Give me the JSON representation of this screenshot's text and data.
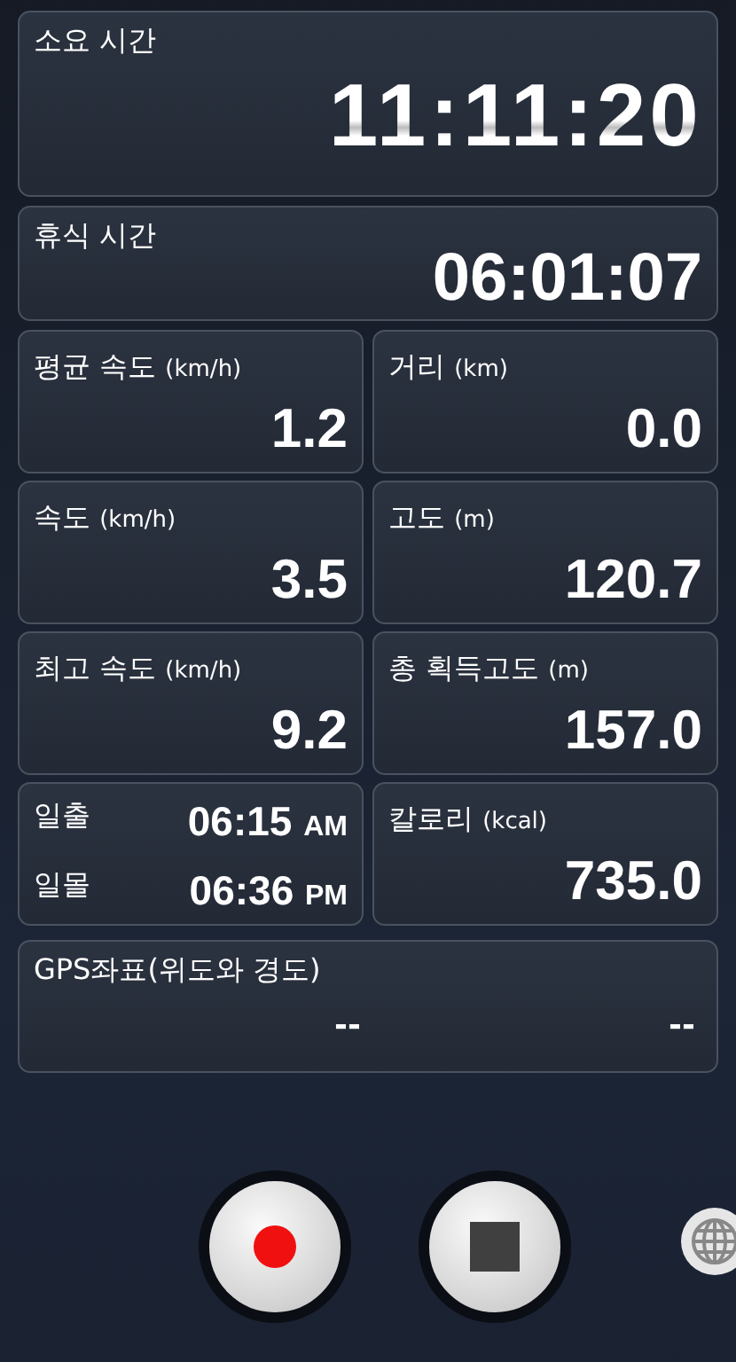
{
  "elapsed": {
    "label": "소요 시간",
    "value": "11:11:20"
  },
  "rest": {
    "label": "휴식 시간",
    "value": "06:01:07"
  },
  "cells": [
    {
      "kind": "stat",
      "label": "평균 속도",
      "unit": "(km/h)",
      "value": "1.2"
    },
    {
      "kind": "stat",
      "label": "거리",
      "unit": "(km)",
      "value": "0.0"
    },
    {
      "kind": "stat",
      "label": "속도",
      "unit": "(km/h)",
      "value": "3.5"
    },
    {
      "kind": "stat",
      "label": "고도",
      "unit": "(m)",
      "value": "120.7"
    },
    {
      "kind": "stat",
      "label": "최고 속도",
      "unit": "(km/h)",
      "value": "9.2"
    },
    {
      "kind": "stat",
      "label": "총 획득고도",
      "unit": "(m)",
      "value": "157.0"
    },
    {
      "kind": "sun",
      "rows": [
        {
          "label": "일출",
          "time": "06:15",
          "ampm": "AM"
        },
        {
          "label": "일몰",
          "time": "06:36",
          "ampm": "PM"
        }
      ]
    },
    {
      "kind": "stat",
      "label": "칼로리",
      "unit": "(kcal)",
      "value": "735.0"
    }
  ],
  "gps": {
    "label": "GPS좌표(위도와 경도)",
    "latitude": "--",
    "longitude": "--"
  }
}
